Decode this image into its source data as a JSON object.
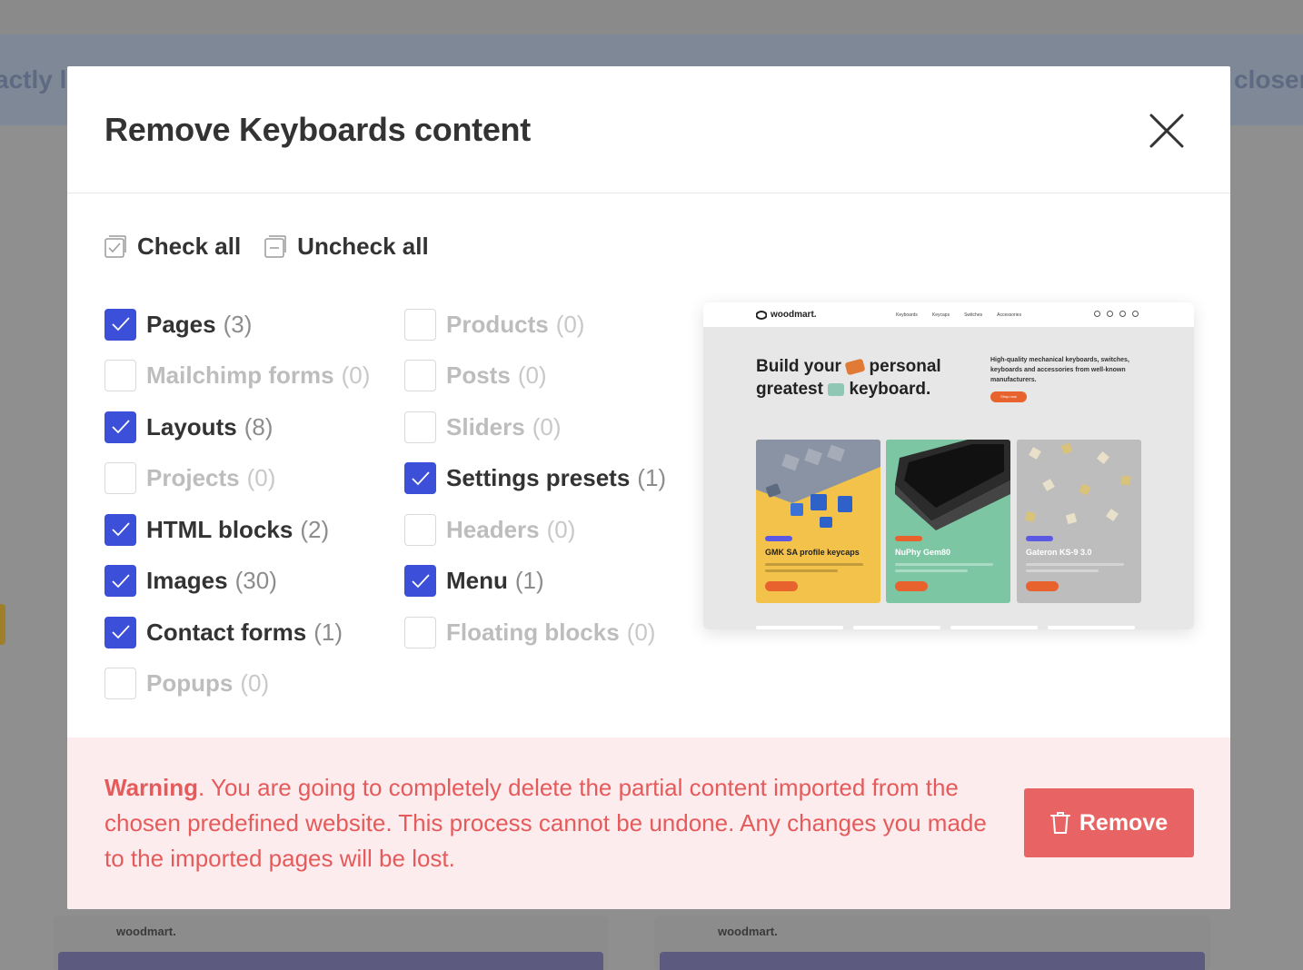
{
  "background": {
    "left_snippet": "actly li",
    "right_snippet": "closer",
    "card_logo": "woodmart."
  },
  "modal": {
    "title": "Remove Keyboards content",
    "close_label": "Close"
  },
  "bulk": {
    "check_all": "Check all",
    "uncheck_all": "Uncheck all"
  },
  "options_left": [
    {
      "label": "Pages",
      "count": "(3)",
      "checked": true
    },
    {
      "label": "Mailchimp forms",
      "count": "(0)",
      "checked": false
    },
    {
      "label": "Layouts",
      "count": "(8)",
      "checked": true
    },
    {
      "label": "Projects",
      "count": "(0)",
      "checked": false
    },
    {
      "label": "HTML blocks",
      "count": "(2)",
      "checked": true
    },
    {
      "label": "Images",
      "count": "(30)",
      "checked": true
    },
    {
      "label": "Contact forms",
      "count": "(1)",
      "checked": true
    },
    {
      "label": "Popups",
      "count": "(0)",
      "checked": false
    }
  ],
  "options_right": [
    {
      "label": "Products",
      "count": "(0)",
      "checked": false
    },
    {
      "label": "Posts",
      "count": "(0)",
      "checked": false
    },
    {
      "label": "Sliders",
      "count": "(0)",
      "checked": false
    },
    {
      "label": "Settings presets",
      "count": "(1)",
      "checked": true
    },
    {
      "label": "Headers",
      "count": "(0)",
      "checked": false
    },
    {
      "label": "Menu",
      "count": "(1)",
      "checked": true
    },
    {
      "label": "Floating blocks",
      "count": "(0)",
      "checked": false
    }
  ],
  "preview": {
    "logo": "woodmart.",
    "nav": [
      "Keyboards",
      "Keycaps",
      "Switches",
      "Accessories"
    ],
    "hero_line1a": "Build your",
    "hero_line1b": "personal",
    "hero_line2a": "greatest",
    "hero_line2b": "keyboard.",
    "description": "High-quality mechanical keyboards, switches, keyboards and accessories from well-known manufacturers.",
    "shop_button": "Shop now",
    "cards": [
      {
        "title": "GMK SA profile keycaps"
      },
      {
        "title": "NuPhy Gem80"
      },
      {
        "title": "Gateron KS-9 3.0"
      }
    ]
  },
  "footer": {
    "warning_label": "Warning",
    "warning_text": ". You are going to completely delete the partial content imported from the chosen predefined website. This process cannot be undone. Any changes you made to the imported pages will be lost.",
    "remove_label": "Remove"
  },
  "colors": {
    "accent": "#3b4fd8",
    "danger": "#e86464",
    "warning_text": "#e55b5b",
    "footer_bg": "#fdecee"
  }
}
